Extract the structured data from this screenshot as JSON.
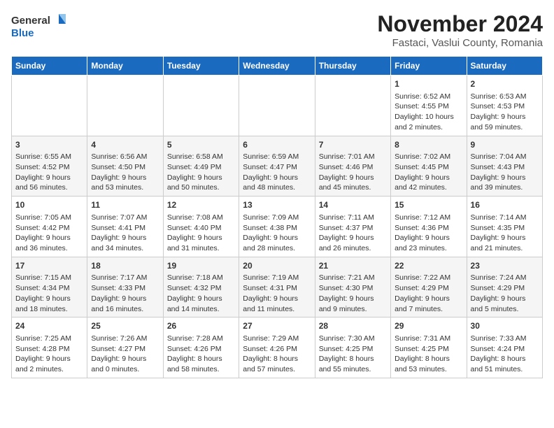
{
  "header": {
    "logo_line1": "General",
    "logo_line2": "Blue",
    "title": "November 2024",
    "subtitle": "Fastaci, Vaslui County, Romania"
  },
  "days_of_week": [
    "Sunday",
    "Monday",
    "Tuesday",
    "Wednesday",
    "Thursday",
    "Friday",
    "Saturday"
  ],
  "weeks": [
    [
      {
        "day": "",
        "content": ""
      },
      {
        "day": "",
        "content": ""
      },
      {
        "day": "",
        "content": ""
      },
      {
        "day": "",
        "content": ""
      },
      {
        "day": "",
        "content": ""
      },
      {
        "day": "1",
        "content": "Sunrise: 6:52 AM\nSunset: 4:55 PM\nDaylight: 10 hours and 2 minutes."
      },
      {
        "day": "2",
        "content": "Sunrise: 6:53 AM\nSunset: 4:53 PM\nDaylight: 9 hours and 59 minutes."
      }
    ],
    [
      {
        "day": "3",
        "content": "Sunrise: 6:55 AM\nSunset: 4:52 PM\nDaylight: 9 hours and 56 minutes."
      },
      {
        "day": "4",
        "content": "Sunrise: 6:56 AM\nSunset: 4:50 PM\nDaylight: 9 hours and 53 minutes."
      },
      {
        "day": "5",
        "content": "Sunrise: 6:58 AM\nSunset: 4:49 PM\nDaylight: 9 hours and 50 minutes."
      },
      {
        "day": "6",
        "content": "Sunrise: 6:59 AM\nSunset: 4:47 PM\nDaylight: 9 hours and 48 minutes."
      },
      {
        "day": "7",
        "content": "Sunrise: 7:01 AM\nSunset: 4:46 PM\nDaylight: 9 hours and 45 minutes."
      },
      {
        "day": "8",
        "content": "Sunrise: 7:02 AM\nSunset: 4:45 PM\nDaylight: 9 hours and 42 minutes."
      },
      {
        "day": "9",
        "content": "Sunrise: 7:04 AM\nSunset: 4:43 PM\nDaylight: 9 hours and 39 minutes."
      }
    ],
    [
      {
        "day": "10",
        "content": "Sunrise: 7:05 AM\nSunset: 4:42 PM\nDaylight: 9 hours and 36 minutes."
      },
      {
        "day": "11",
        "content": "Sunrise: 7:07 AM\nSunset: 4:41 PM\nDaylight: 9 hours and 34 minutes."
      },
      {
        "day": "12",
        "content": "Sunrise: 7:08 AM\nSunset: 4:40 PM\nDaylight: 9 hours and 31 minutes."
      },
      {
        "day": "13",
        "content": "Sunrise: 7:09 AM\nSunset: 4:38 PM\nDaylight: 9 hours and 28 minutes."
      },
      {
        "day": "14",
        "content": "Sunrise: 7:11 AM\nSunset: 4:37 PM\nDaylight: 9 hours and 26 minutes."
      },
      {
        "day": "15",
        "content": "Sunrise: 7:12 AM\nSunset: 4:36 PM\nDaylight: 9 hours and 23 minutes."
      },
      {
        "day": "16",
        "content": "Sunrise: 7:14 AM\nSunset: 4:35 PM\nDaylight: 9 hours and 21 minutes."
      }
    ],
    [
      {
        "day": "17",
        "content": "Sunrise: 7:15 AM\nSunset: 4:34 PM\nDaylight: 9 hours and 18 minutes."
      },
      {
        "day": "18",
        "content": "Sunrise: 7:17 AM\nSunset: 4:33 PM\nDaylight: 9 hours and 16 minutes."
      },
      {
        "day": "19",
        "content": "Sunrise: 7:18 AM\nSunset: 4:32 PM\nDaylight: 9 hours and 14 minutes."
      },
      {
        "day": "20",
        "content": "Sunrise: 7:19 AM\nSunset: 4:31 PM\nDaylight: 9 hours and 11 minutes."
      },
      {
        "day": "21",
        "content": "Sunrise: 7:21 AM\nSunset: 4:30 PM\nDaylight: 9 hours and 9 minutes."
      },
      {
        "day": "22",
        "content": "Sunrise: 7:22 AM\nSunset: 4:29 PM\nDaylight: 9 hours and 7 minutes."
      },
      {
        "day": "23",
        "content": "Sunrise: 7:24 AM\nSunset: 4:29 PM\nDaylight: 9 hours and 5 minutes."
      }
    ],
    [
      {
        "day": "24",
        "content": "Sunrise: 7:25 AM\nSunset: 4:28 PM\nDaylight: 9 hours and 2 minutes."
      },
      {
        "day": "25",
        "content": "Sunrise: 7:26 AM\nSunset: 4:27 PM\nDaylight: 9 hours and 0 minutes."
      },
      {
        "day": "26",
        "content": "Sunrise: 7:28 AM\nSunset: 4:26 PM\nDaylight: 8 hours and 58 minutes."
      },
      {
        "day": "27",
        "content": "Sunrise: 7:29 AM\nSunset: 4:26 PM\nDaylight: 8 hours and 57 minutes."
      },
      {
        "day": "28",
        "content": "Sunrise: 7:30 AM\nSunset: 4:25 PM\nDaylight: 8 hours and 55 minutes."
      },
      {
        "day": "29",
        "content": "Sunrise: 7:31 AM\nSunset: 4:25 PM\nDaylight: 8 hours and 53 minutes."
      },
      {
        "day": "30",
        "content": "Sunrise: 7:33 AM\nSunset: 4:24 PM\nDaylight: 8 hours and 51 minutes."
      }
    ]
  ]
}
